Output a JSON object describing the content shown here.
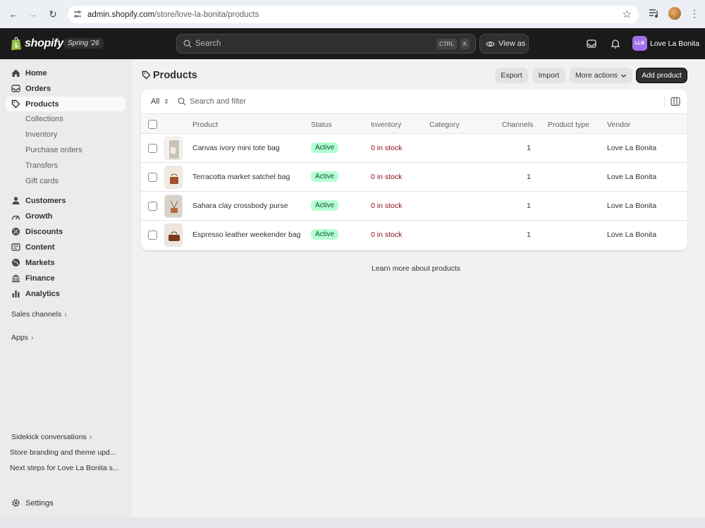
{
  "browser": {
    "url_host": "admin.shopify.com",
    "url_path": "/store/love-la-bonita/products"
  },
  "topbar": {
    "brand": "shopify",
    "edition": "Spring '26",
    "search_placeholder": "Search",
    "shortcut_ctrl": "CTRL",
    "shortcut_key": "K",
    "view_as": "View as",
    "store_initials": "LLB",
    "store_name": "Love La Bonita"
  },
  "sidebar": {
    "main_items": [
      {
        "label": "Home",
        "icon": "home-icon"
      },
      {
        "label": "Orders",
        "icon": "orders-icon"
      },
      {
        "label": "Products",
        "icon": "tag-icon",
        "active": true
      }
    ],
    "product_subitems": [
      "Collections",
      "Inventory",
      "Purchase orders",
      "Transfers",
      "Gift cards"
    ],
    "more_items": [
      {
        "label": "Customers",
        "icon": "person-icon"
      },
      {
        "label": "Growth",
        "icon": "growth-icon"
      },
      {
        "label": "Discounts",
        "icon": "discount-icon"
      },
      {
        "label": "Content",
        "icon": "content-icon"
      },
      {
        "label": "Markets",
        "icon": "globe-icon"
      },
      {
        "label": "Finance",
        "icon": "bank-icon"
      },
      {
        "label": "Analytics",
        "icon": "chart-icon"
      }
    ],
    "sales_channels": "Sales channels",
    "apps": "Apps",
    "sidekick": "Sidekick conversations",
    "recent_conversations": [
      "Store branding and theme upd...",
      "Next steps for Love La Bonita s..."
    ],
    "settings": "Settings"
  },
  "page": {
    "title": "Products",
    "buttons": {
      "export": "Export",
      "import": "Import",
      "more_actions": "More actions",
      "add_product": "Add product"
    },
    "filter": {
      "tab": "All",
      "search_placeholder": "Search and filter"
    },
    "columns": [
      "Product",
      "Status",
      "Inventory",
      "Category",
      "Channels",
      "Product type",
      "Vendor"
    ],
    "rows": [
      {
        "product": "Canvas ivory mini tote bag",
        "status": "Active",
        "inventory": "0 in stock",
        "category": "",
        "channels": "1",
        "product_type": "",
        "vendor": "Love La Bonita",
        "thumb": "tote"
      },
      {
        "product": "Terracotta market satchel bag",
        "status": "Active",
        "inventory": "0 in stock",
        "category": "",
        "channels": "1",
        "product_type": "",
        "vendor": "Love La Bonita",
        "thumb": "satchel"
      },
      {
        "product": "Sahara clay crossbody purse",
        "status": "Active",
        "inventory": "0 in stock",
        "category": "",
        "channels": "1",
        "product_type": "",
        "vendor": "Love La Bonita",
        "thumb": "crossbody"
      },
      {
        "product": "Espresso leather weekender bag",
        "status": "Active",
        "inventory": "0 in stock",
        "category": "",
        "channels": "1",
        "product_type": "",
        "vendor": "Love La Bonita",
        "thumb": "weekender"
      }
    ],
    "learn_more": "Learn more about products"
  },
  "colors": {
    "topbar_bg": "#1a1a1a",
    "sidebar_bg": "#ebebeb",
    "active_badge_bg": "#b4fed2",
    "active_badge_text": "#0c5132",
    "stock_text": "#8e0b21",
    "store_badge": "#9e72e8"
  }
}
